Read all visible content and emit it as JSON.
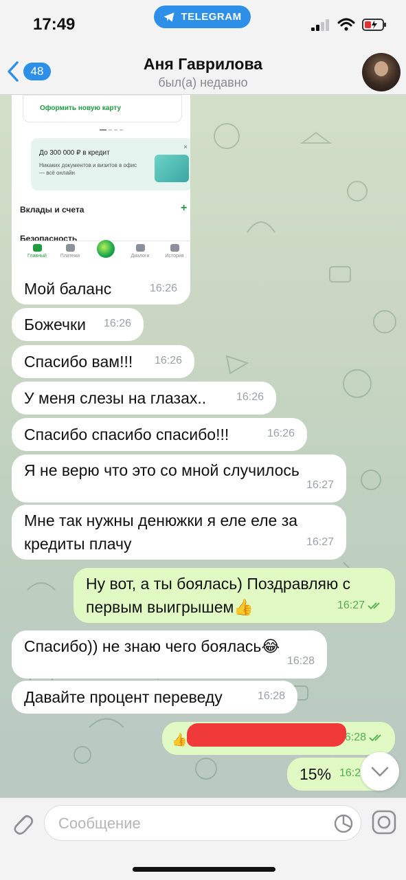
{
  "status_bar": {
    "time": "17:49",
    "telegram_pill": "TELEGRAM"
  },
  "header": {
    "back_badge": "48",
    "contact_name": "Аня Гаврилова",
    "contact_status": "был(а) недавно"
  },
  "shared_screenshot": {
    "new_card_link": "Оформить новую карту",
    "credit_title": "До 300 000 ₽ в кредит",
    "credit_desc": "Никаких документов и визитов в офис — всё онлайн",
    "close_glyph": "×",
    "section_deposits": "Вклады и счета",
    "section_security": "Безопасность",
    "tabs": [
      "Главный",
      "Платежи",
      "",
      "Диалоги",
      "История"
    ]
  },
  "messages": [
    {
      "dir": "in",
      "text": "Мой баланс",
      "time": "16:26"
    },
    {
      "dir": "in",
      "text": "Божечки",
      "time": "16:26"
    },
    {
      "dir": "in",
      "text": "Спасибо вам!!!",
      "time": "16:26"
    },
    {
      "dir": "in",
      "text": "У меня слезы на глазах..",
      "time": "16:26"
    },
    {
      "dir": "in",
      "text": "Спасибо спасибо спасибо!!!",
      "time": "16:26"
    },
    {
      "dir": "in",
      "text": "Я не верю что это со мной случилось",
      "time": "16:27"
    },
    {
      "dir": "in",
      "text": "Мне так нужны денюжки я еле еле за кредиты плачу",
      "time": "16:27"
    },
    {
      "dir": "out",
      "text": "Ну вот, а ты боялась) Поздравляю с первым выигрышем👍",
      "time": "16:27"
    },
    {
      "dir": "in",
      "text": "Спасибо)) не знаю чего боялась😂",
      "time": "16:28"
    },
    {
      "dir": "in",
      "text": "Давайте процент переведу",
      "time": "16:28"
    },
    {
      "dir": "out",
      "text": "👍",
      "time": "16:28"
    },
    {
      "dir": "out",
      "text": "15%",
      "time": "16:2"
    }
  ],
  "composer": {
    "placeholder": "Сообщение"
  },
  "colors": {
    "accent": "#2d8fe8",
    "outgoing_bubble": "#e1fac4",
    "incoming_bubble": "#ffffff",
    "read_check": "#4fae4e"
  }
}
